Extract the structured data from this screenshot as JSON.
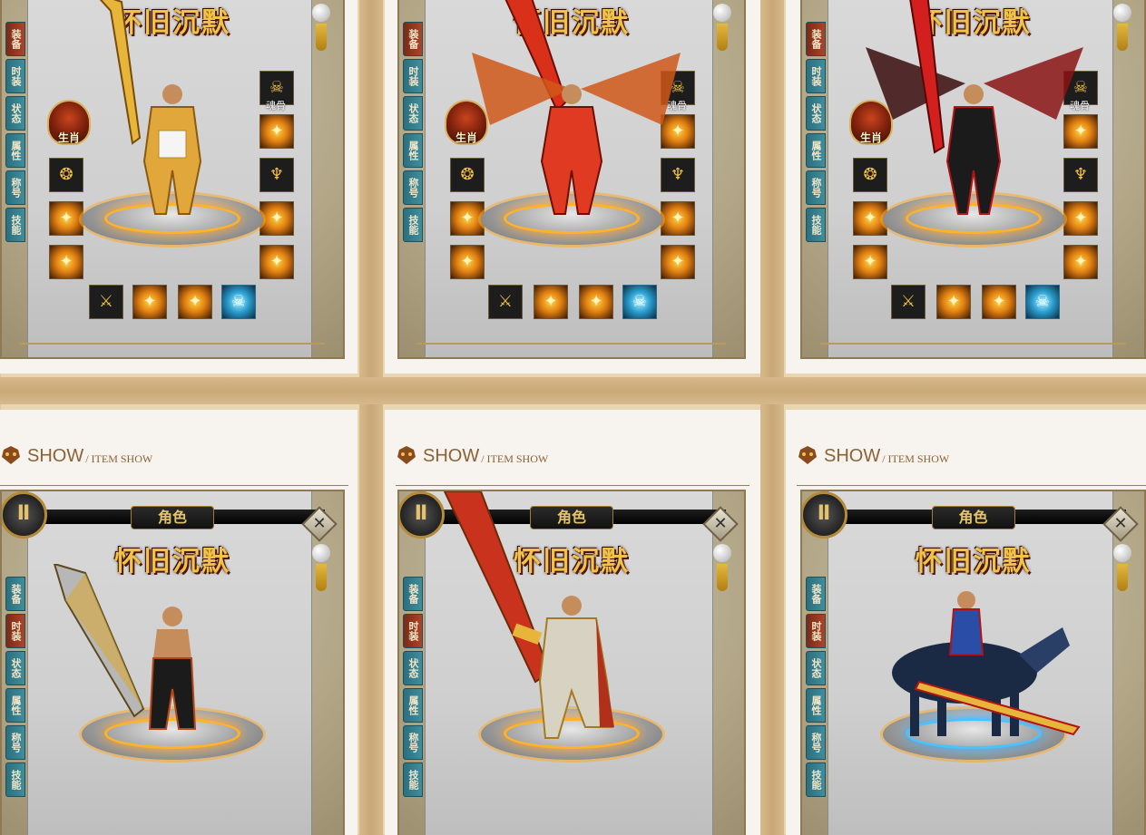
{
  "colors": {
    "page_bg": "#e8d5b2",
    "card_bg": "#f7f3ee",
    "heading": "#8a6236",
    "tab_teal": "#2c6f7d",
    "tab_active": "#b0432a",
    "gold": "#f0c24a"
  },
  "game_title": "怀旧沉默",
  "role_tab": "角色",
  "side_tabs": [
    "装备",
    "时装",
    "状态",
    "属性",
    "称号",
    "技能"
  ],
  "slot_labels": {
    "soul_bone": "魂骨",
    "zodiac": "生肖"
  },
  "close_glyph": "✕",
  "section": {
    "main": "SHOW",
    "sub": "/ ITEM SHOW",
    "icon": "demon-mask-icon"
  },
  "cards": [
    {
      "name": "equip-top-1",
      "active_tab": 0,
      "character": "golden-armor-warrior"
    },
    {
      "name": "equip-top-2",
      "active_tab": 0,
      "character": "flame-wing-warrior"
    },
    {
      "name": "equip-top-3",
      "active_tab": 0,
      "character": "demon-wing-warrior"
    },
    {
      "name": "fashion-bottom-1",
      "active_tab": 1,
      "character": "bald-saber-fighter"
    },
    {
      "name": "fashion-bottom-2",
      "active_tab": 1,
      "character": "golden-blade-knight"
    },
    {
      "name": "fashion-bottom-3",
      "active_tab": 1,
      "character": "spectral-horse-rider"
    }
  ]
}
